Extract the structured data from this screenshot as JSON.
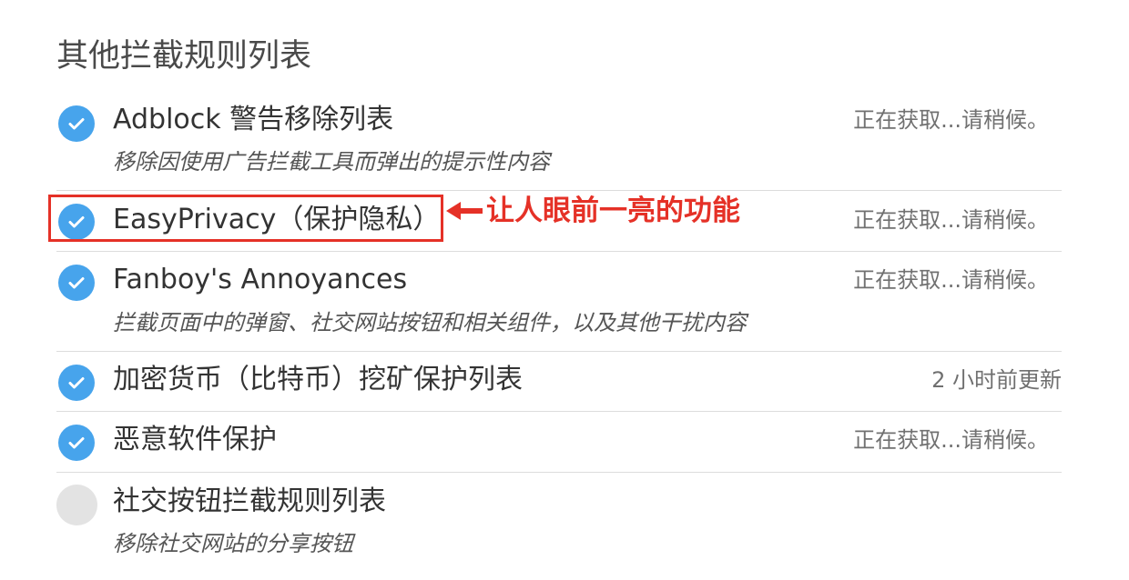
{
  "section": {
    "title": "其他拦截规则列表"
  },
  "annotation": {
    "text": "让人眼前一亮的功能",
    "color": "#e53127"
  },
  "items": [
    {
      "name": "Adblock 警告移除列表",
      "description": "移除因使用广告拦截工具而弹出的提示性内容",
      "status": "正在获取...请稍候。",
      "checked": true
    },
    {
      "name": "EasyPrivacy（保护隐私）",
      "description": "",
      "status": "正在获取...请稍候。",
      "checked": true
    },
    {
      "name": "Fanboy's Annoyances",
      "description": "拦截页面中的弹窗、社交网站按钮和相关组件，以及其他干扰内容",
      "status": "正在获取...请稍候。",
      "checked": true
    },
    {
      "name": "加密货币（比特币）挖矿保护列表",
      "description": "",
      "status": "2 小时前更新",
      "checked": true
    },
    {
      "name": "恶意软件保护",
      "description": "",
      "status": "正在获取...请稍候。",
      "checked": true
    },
    {
      "name": "社交按钮拦截规则列表",
      "description": "移除社交网站的分享按钮",
      "status": "",
      "checked": false
    }
  ],
  "colors": {
    "checked": "#47a4ec",
    "unchecked": "#e3e3e3"
  },
  "icons": {
    "checked": "check-icon",
    "unchecked": "empty-circle-icon"
  }
}
